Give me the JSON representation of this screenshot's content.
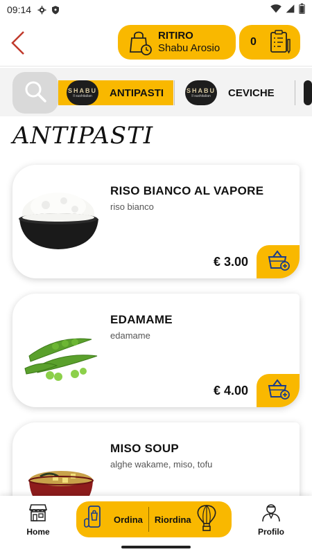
{
  "status_bar": {
    "time": "09:14"
  },
  "header": {
    "pickup_title": "RITIRO",
    "pickup_store": "Shabu Arosio",
    "cart_count": "0"
  },
  "categories": [
    {
      "logo": "SHABU",
      "logo_sub": "Il sushitalian",
      "label": "ANTIPASTI",
      "active": true
    },
    {
      "logo": "SHABU",
      "logo_sub": "Il sushitalian",
      "label": "CEVICHE",
      "active": false
    }
  ],
  "section_title": "ANTIPASTI",
  "products": [
    {
      "name": "RISO BIANCO AL VAPORE",
      "description": "riso bianco",
      "price": "€ 3.00"
    },
    {
      "name": "EDAMAME",
      "description": "edamame",
      "price": "€ 4.00"
    },
    {
      "name": "MISO SOUP",
      "description": "alghe wakame, miso, tofu",
      "price": ""
    }
  ],
  "bottom_nav": {
    "home": "Home",
    "order": "Ordina",
    "reorder": "Riordina",
    "profile": "Profilo"
  },
  "colors": {
    "accent": "#f9b800",
    "back_arrow": "#c0392b"
  }
}
